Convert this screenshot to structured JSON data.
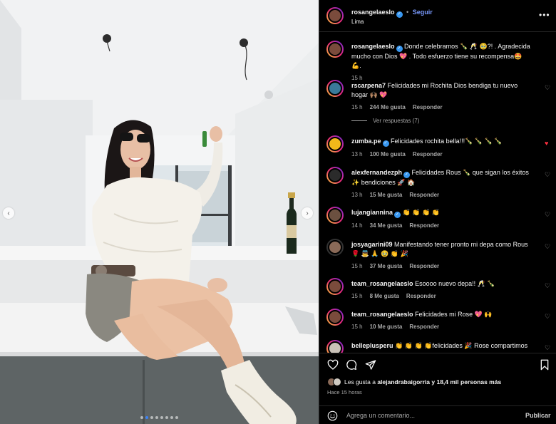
{
  "media": {
    "carousel_dots": 8,
    "active_dot_index": 1,
    "prev_icon": "chevron-left-icon",
    "next_icon": "chevron-right-icon"
  },
  "post": {
    "username": "rosangelaeslo",
    "separator": "•",
    "follow_label": "Seguir",
    "location": "Lima",
    "more_icon": "more-options-icon"
  },
  "caption": {
    "username": "rosangelaeslo",
    "text": "Donde celebramos 🍾 🥂 🥹?! . Agradecida mucho con Dios 💖 . Todo esfuerzo tiene su recompensa🤩 💪.",
    "time": "15 h"
  },
  "comments": [
    {
      "username": "rscarpena7",
      "verified": false,
      "text": "Felicidades mi Rochita Dios bendiga tu nuevo hogar 🙌🏽 💖",
      "time": "15 h",
      "likes": "244 Me gusta",
      "reply": "Responder",
      "liked": false,
      "view_replies": "Ver respuestas (7)"
    },
    {
      "username": "zumba.pe",
      "verified": true,
      "text": "Felicidades rochita bella!!!🍾 🍾 🍾 🍾",
      "time": "13 h",
      "likes": "100 Me gusta",
      "reply": "Responder",
      "liked": true
    },
    {
      "username": "alexfernandezph",
      "verified": true,
      "text": "Felicidades Rous 🍾 que sigan los éxitos ✨ bendiciones 🚀 🏠",
      "time": "13 h",
      "likes": "15 Me gusta",
      "reply": "Responder",
      "liked": false
    },
    {
      "username": "lujangiannina",
      "verified": true,
      "text": "👏 👏 👏 👏",
      "time": "14 h",
      "likes": "34 Me gusta",
      "reply": "Responder",
      "liked": false
    },
    {
      "username": "josyagarini09",
      "verified": false,
      "text": "Manifestando tener pronto mi depa como Rous 🌹 👼 🙏 🥹 👏 🎉",
      "time": "15 h",
      "likes": "37 Me gusta",
      "reply": "Responder",
      "liked": false
    },
    {
      "username": "team_rosangelaeslo",
      "verified": false,
      "text": "Esoooo nuevo depa!! 🥂 🍾",
      "time": "15 h",
      "likes": "8 Me gusta",
      "reply": "Responder",
      "liked": false
    },
    {
      "username": "team_rosangelaeslo",
      "verified": false,
      "text": "Felicidades mi Rose 💖 🙌",
      "time": "15 h",
      "likes": "10 Me gusta",
      "reply": "Responder",
      "liked": false
    },
    {
      "username": "belleplusperu",
      "verified": false,
      "text": "👏 👏 👏 👏felicidades 🎉 Rose compartimos tu",
      "time": "",
      "likes": "",
      "reply": "",
      "liked": false
    }
  ],
  "actions": {
    "like_icon": "heart-icon",
    "comment_icon": "comment-icon",
    "share_icon": "share-icon",
    "save_icon": "bookmark-icon",
    "likes_prefix": "Les gusta a ",
    "likes_user": "alejandrabaigorria",
    "likes_suffix": " y 18,4 mil personas más",
    "time_ago": "Hace 15 horas"
  },
  "comment_bar": {
    "emoji_icon": "emoji-icon",
    "placeholder": "Agrega un comentario...",
    "post_label": "Publicar"
  },
  "colors": {
    "background": "#000000",
    "accent": "#3897f0",
    "follow": "#7a9bff",
    "like_red": "#ff3040",
    "muted": "#a8a8a8"
  }
}
